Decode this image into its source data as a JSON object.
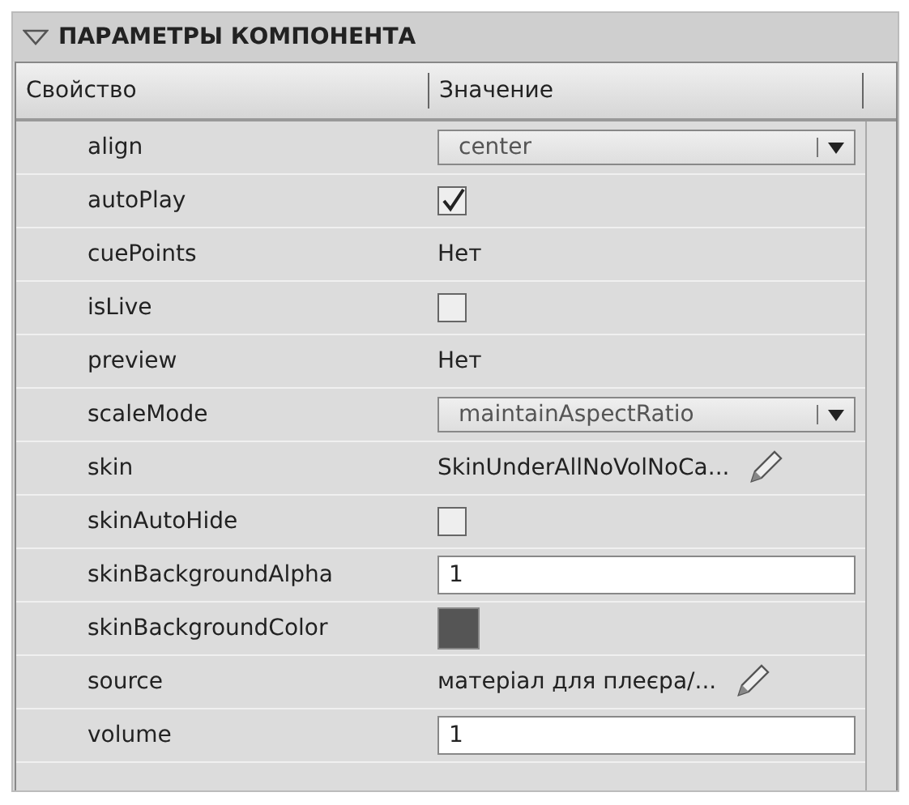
{
  "panel": {
    "title": "ПАРАМЕТРЫ КОМПОНЕНТА",
    "expanded": true
  },
  "columns": [
    "Свойство",
    "Значение"
  ],
  "rows": [
    {
      "name": "align",
      "kind": "dropdown",
      "value": "center"
    },
    {
      "name": "autoPlay",
      "kind": "checkbox",
      "checked": true
    },
    {
      "name": "cuePoints",
      "kind": "text",
      "value": "Нет"
    },
    {
      "name": "isLive",
      "kind": "checkbox",
      "checked": false
    },
    {
      "name": "preview",
      "kind": "text",
      "value": "Нет"
    },
    {
      "name": "scaleMode",
      "kind": "dropdown",
      "value": "maintainAspectRatio"
    },
    {
      "name": "skin",
      "kind": "editable",
      "value": "SkinUnderAllNoVolNoCa..."
    },
    {
      "name": "skinAutoHide",
      "kind": "checkbox",
      "checked": false
    },
    {
      "name": "skinBackgroundAlpha",
      "kind": "input",
      "value": "1"
    },
    {
      "name": "skinBackgroundColor",
      "kind": "color",
      "color": "#555555"
    },
    {
      "name": "source",
      "kind": "editable",
      "value": "матеріал для плеєра/..."
    },
    {
      "name": "volume",
      "kind": "input",
      "value": "1"
    }
  ]
}
